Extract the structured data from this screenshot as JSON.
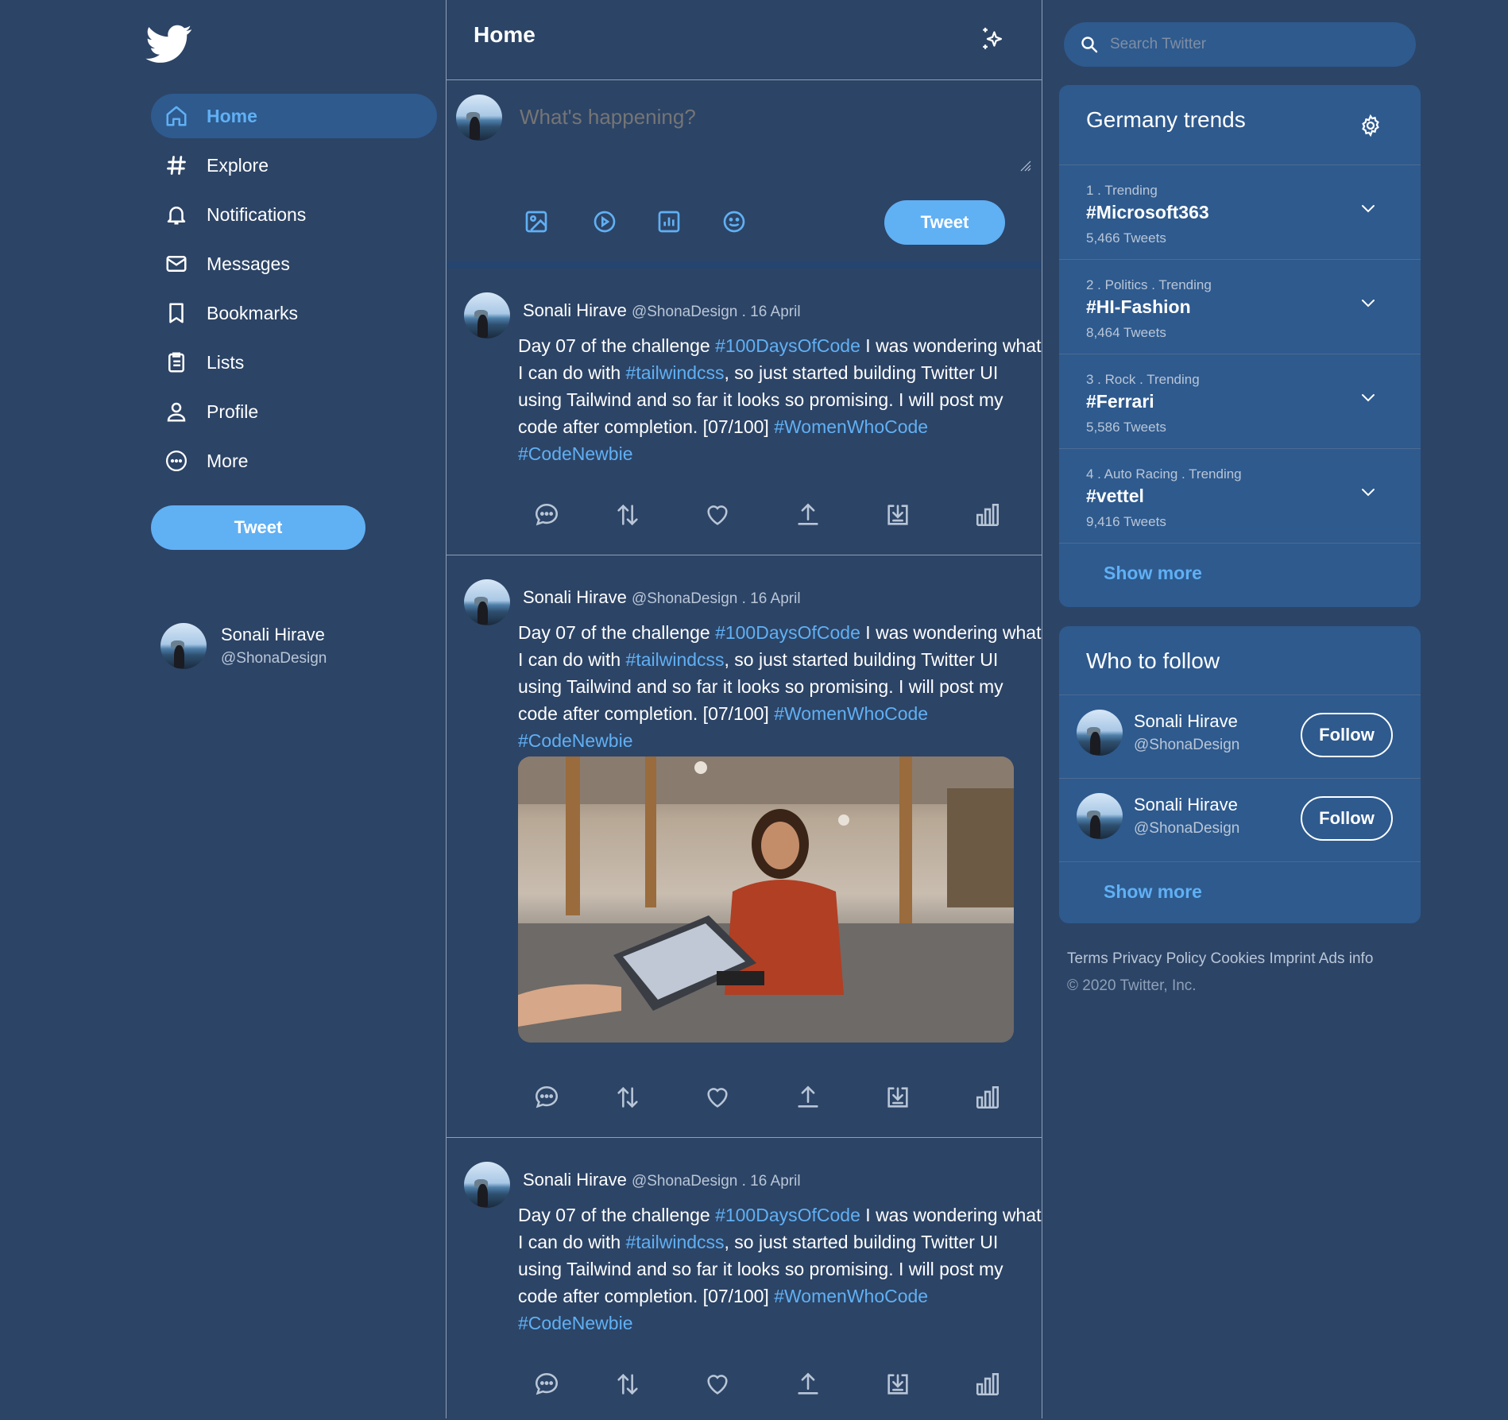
{
  "colors": {
    "background": "#2c4466",
    "card": "#2e5a8e",
    "accent": "#60b0f4"
  },
  "sidebar": {
    "logo_icon": "twitter-bird-icon",
    "nav": [
      {
        "label": "Home",
        "icon": "home-icon",
        "active": true
      },
      {
        "label": "Explore",
        "icon": "hashtag-icon"
      },
      {
        "label": "Notifications",
        "icon": "bell-icon"
      },
      {
        "label": "Messages",
        "icon": "envelope-icon"
      },
      {
        "label": "Bookmarks",
        "icon": "bookmark-icon"
      },
      {
        "label": "Lists",
        "icon": "list-icon"
      },
      {
        "label": "Profile",
        "icon": "user-icon"
      },
      {
        "label": "More",
        "icon": "more-icon"
      }
    ],
    "tweet_button": "Tweet",
    "account": {
      "name": "Sonali Hirave",
      "handle": "@ShonaDesign"
    }
  },
  "main": {
    "title": "Home",
    "compose": {
      "placeholder": "What's happening?",
      "tweet_button": "Tweet"
    },
    "tweets": [
      {
        "name": "Sonali Hirave",
        "handle_date": "@ShonaDesign . 16 April",
        "text": [
          "Day 07 of the challenge ",
          "#100DaysOfCode",
          " I was wondering what I can do with ",
          "#tailwindcss",
          ", so just started building Twitter UI using Tailwind and so far it looks so promising. I will post my code after completion. [07/100] ",
          "#WomenWhoCode",
          " ",
          "#CodeNewbie"
        ],
        "has_image": false
      },
      {
        "name": "Sonali Hirave",
        "handle_date": "@ShonaDesign . 16 April",
        "text": [
          "Day 07 of the challenge ",
          "#100DaysOfCode",
          " I was wondering what I can do with ",
          "#tailwindcss",
          ", so just started building Twitter UI using Tailwind and so far it looks so promising. I will post my code after completion. [07/100] ",
          "#WomenWhoCode",
          " ",
          "#CodeNewbie"
        ],
        "has_image": true
      },
      {
        "name": "Sonali Hirave",
        "handle_date": "@ShonaDesign . 16 April",
        "text": [
          "Day 07 of the challenge ",
          "#100DaysOfCode",
          " I was wondering what I can do with ",
          "#tailwindcss",
          ", so just started building Twitter UI using Tailwind and so far it looks so promising. I will post my code after completion. [07/100] ",
          "#WomenWhoCode",
          " ",
          "#CodeNewbie"
        ],
        "has_image": false
      }
    ]
  },
  "right": {
    "search_placeholder": "Search Twitter",
    "trends": {
      "title": "Germany trends",
      "items": [
        {
          "context": "1 . Trending",
          "tag": "#Microsoft363",
          "count": "5,466 Tweets"
        },
        {
          "context": "2 . Politics . Trending",
          "tag": "#HI-Fashion",
          "count": "8,464 Tweets"
        },
        {
          "context": "3 . Rock . Trending",
          "tag": "#Ferrari",
          "count": "5,586 Tweets"
        },
        {
          "context": "4 . Auto Racing . Trending",
          "tag": "#vettel",
          "count": "9,416 Tweets"
        }
      ],
      "show_more": "Show more"
    },
    "who_to_follow": {
      "title": "Who to follow",
      "items": [
        {
          "name": "Sonali Hirave",
          "handle": "@ShonaDesign",
          "button": "Follow"
        },
        {
          "name": "Sonali Hirave",
          "handle": "@ShonaDesign",
          "button": "Follow"
        }
      ],
      "show_more": "Show more"
    },
    "footer": {
      "links": "Terms Privacy Policy Cookies Imprint Ads info",
      "copyright": "© 2020 Twitter, Inc."
    }
  }
}
